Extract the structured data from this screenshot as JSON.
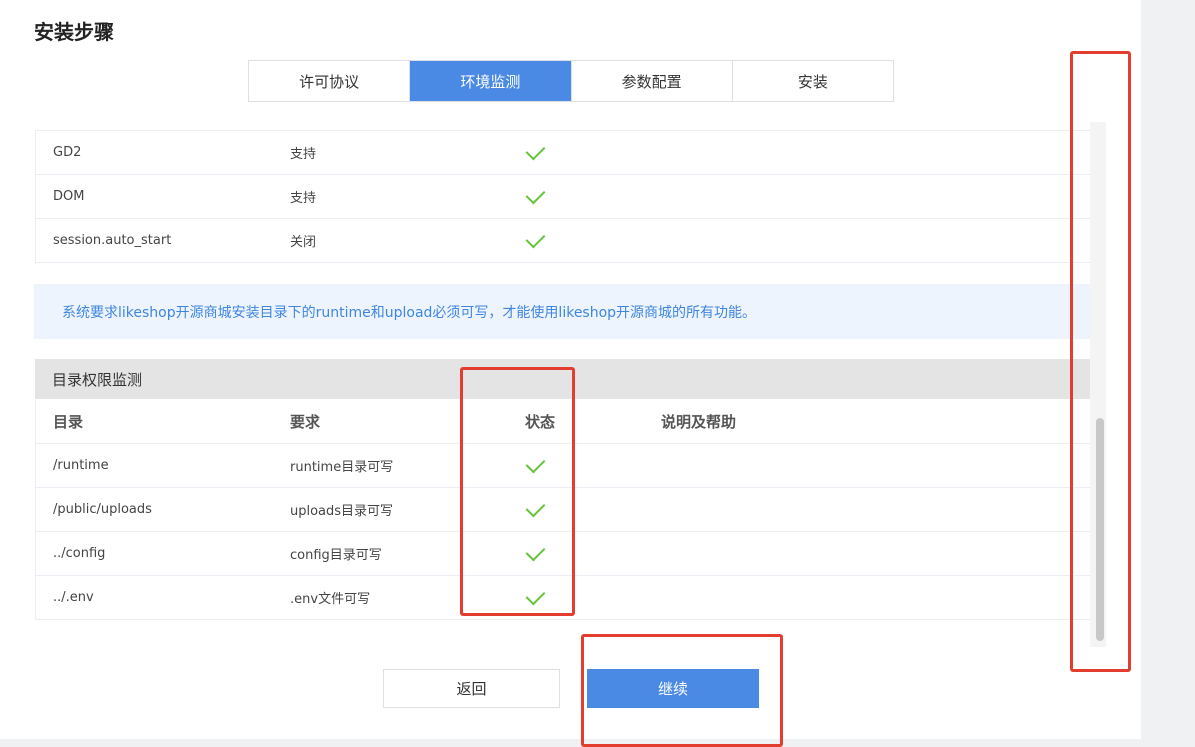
{
  "page": {
    "title": "安装步骤"
  },
  "tabs": [
    {
      "label": "许可协议",
      "active": false
    },
    {
      "label": "环境监测",
      "active": true
    },
    {
      "label": "参数配置",
      "active": false
    },
    {
      "label": "安装",
      "active": false
    }
  ],
  "env_checks": [
    {
      "name": "GD2",
      "value": "支持",
      "status": "ok"
    },
    {
      "name": "DOM",
      "value": "支持",
      "status": "ok"
    },
    {
      "name": "session.auto_start",
      "value": "关闭",
      "status": "ok"
    }
  ],
  "notice": {
    "text": "系统要求likeshop开源商城安装目录下的runtime和upload必须可写，才能使用likeshop开源商城的所有功能。"
  },
  "directory_section": {
    "title": "目录权限监测",
    "headers": {
      "dir": "目录",
      "requirement": "要求",
      "status": "状态",
      "help": "说明及帮助"
    },
    "rows": [
      {
        "dir": "/runtime",
        "requirement": "runtime目录可写",
        "status": "ok"
      },
      {
        "dir": "/public/uploads",
        "requirement": "uploads目录可写",
        "status": "ok"
      },
      {
        "dir": "../config",
        "requirement": "config目录可写",
        "status": "ok"
      },
      {
        "dir": "../.env",
        "requirement": ".env文件可写",
        "status": "ok"
      }
    ]
  },
  "buttons": {
    "back": "返回",
    "next": "继续"
  },
  "colors": {
    "accent": "#4a8ae4",
    "check": "#67c23a",
    "highlight": "#e23d2e",
    "notice_text": "#3f86e0"
  }
}
